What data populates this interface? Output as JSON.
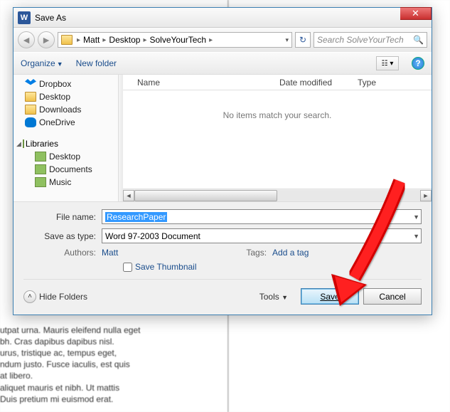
{
  "window": {
    "title": "Save As",
    "app_icon_letter": "W"
  },
  "nav": {
    "breadcrumb": [
      "Matt",
      "Desktop",
      "SolveYourTech"
    ],
    "search_placeholder": "Search SolveYourTech"
  },
  "toolbar": {
    "organize": "Organize",
    "new_folder": "New folder"
  },
  "tree": {
    "items": [
      {
        "icon": "dropbox",
        "label": "Dropbox"
      },
      {
        "icon": "folder",
        "label": "Desktop"
      },
      {
        "icon": "folder",
        "label": "Downloads"
      },
      {
        "icon": "onedrive",
        "label": "OneDrive"
      }
    ],
    "libraries_label": "Libraries",
    "lib_items": [
      {
        "icon": "doc",
        "label": "Desktop"
      },
      {
        "icon": "doc",
        "label": "Documents"
      },
      {
        "icon": "doc",
        "label": "Music"
      }
    ]
  },
  "filelist": {
    "headers": [
      "Name",
      "Date modified",
      "Type"
    ],
    "empty_msg": "No items match your search."
  },
  "form": {
    "filename_label": "File name:",
    "filename_value": "ResearchPaper",
    "savetype_label": "Save as type:",
    "savetype_value": "Word 97-2003 Document",
    "authors_label": "Authors:",
    "authors_value": "Matt",
    "tags_label": "Tags:",
    "tags_value": "Add a tag",
    "thumbnail_label": "Save Thumbnail"
  },
  "footer": {
    "hide_folders": "Hide Folders",
    "tools": "Tools",
    "save": "Save",
    "cancel": "Cancel"
  },
  "bg_text_lines": [
    "utpat urna. Mauris eleifend nulla eget",
    "bh. Cras dapibus dapibus nisl.",
    "urus, tristique ac, tempus eget,",
    "ndum justo. Fusce iaculis, est quis",
    "at libero.",
    "aliquet mauris et nibh. Ut mattis",
    "Duis pretium mi euismod erat."
  ]
}
